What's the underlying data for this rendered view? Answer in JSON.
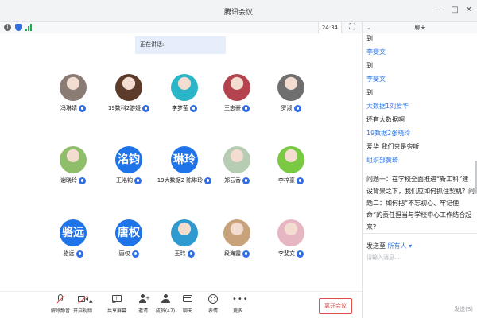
{
  "window": {
    "title": "腾讯会议"
  },
  "meeting_bar": {
    "timer": "24:34",
    "info_icon": "info-icon",
    "security_icon": "shield-icon",
    "signal_icon": "signal-icon",
    "fullscreen_icon": "fullscreen-icon"
  },
  "speaking_label": "正在讲话:",
  "participants": [
    {
      "name": "冯琳婧",
      "initials": "",
      "color": "#8a7b74"
    },
    {
      "name": "19数科2游娅",
      "initials": "",
      "color": "#5d3b2b"
    },
    {
      "name": "李梦莹",
      "initials": "",
      "color": "#2bb5c8"
    },
    {
      "name": "王志豪",
      "initials": "",
      "color": "#b4434e"
    },
    {
      "name": "罗淑",
      "initials": "",
      "color": "#6f6f6f"
    },
    {
      "name": "谢晓玲",
      "initials": "",
      "color": "#8fbe6a"
    },
    {
      "name": "王洺钧",
      "initials": "洺钧",
      "color": "#1e74e8"
    },
    {
      "name": "19大数据2 陈琳玲",
      "initials": "琳玲",
      "color": "#1e74e8"
    },
    {
      "name": "郑云香",
      "initials": "",
      "color": "#b7cdb3"
    },
    {
      "name": "李梓豪",
      "initials": "",
      "color": "#7ac943"
    },
    {
      "name": "骆远",
      "initials": "骆远",
      "color": "#1e74e8"
    },
    {
      "name": "唐权",
      "initials": "唐权",
      "color": "#1e74e8"
    },
    {
      "name": "王玮",
      "initials": "",
      "color": "#2e9ad0"
    },
    {
      "name": "段海霞",
      "initials": "",
      "color": "#c8a27a"
    },
    {
      "name": "李斐文",
      "initials": "",
      "color": "#e6b7c2"
    }
  ],
  "controls": [
    {
      "label": "解除静音",
      "icon": "muted-mic-icon"
    },
    {
      "label": "开启视频",
      "icon": "video-off-icon"
    },
    {
      "label": "共享屏幕",
      "icon": "share-screen-icon"
    },
    {
      "label": "邀请",
      "icon": "invite-icon"
    },
    {
      "label": "成员(47)",
      "icon": "members-icon"
    },
    {
      "label": "聊天",
      "icon": "chat-icon"
    },
    {
      "label": "表情",
      "icon": "emoji-icon"
    },
    {
      "label": "更多",
      "icon": "more-icon"
    }
  ],
  "leave_label": "离开会议",
  "chat": {
    "title": "聊天",
    "messages": [
      {
        "type": "body",
        "text": "到"
      },
      {
        "type": "sender",
        "text": "李斐文"
      },
      {
        "type": "body",
        "text": "到"
      },
      {
        "type": "sender",
        "text": "李斐文"
      },
      {
        "type": "body",
        "text": "到"
      },
      {
        "type": "sender",
        "text": "大数据1刘爱华"
      },
      {
        "type": "body",
        "text": "还有大数据啊"
      },
      {
        "type": "sender",
        "text": "19数据2张晓玲"
      },
      {
        "type": "body",
        "text": "爱华 我们只是旁听"
      },
      {
        "type": "sender",
        "text": "组织部黄琦"
      }
    ],
    "long_message": "问题一：在学校全面推进“新工科”建设背景之下，我们应如何抓住契机？问题二：如何把“不忘初心、牢记使命”的责任担当与学校中心工作结合起来？",
    "send_to_label": "发送至",
    "send_to_target": "所有人",
    "input_placeholder": "请输入消息...",
    "send_button": "发送(S)"
  }
}
